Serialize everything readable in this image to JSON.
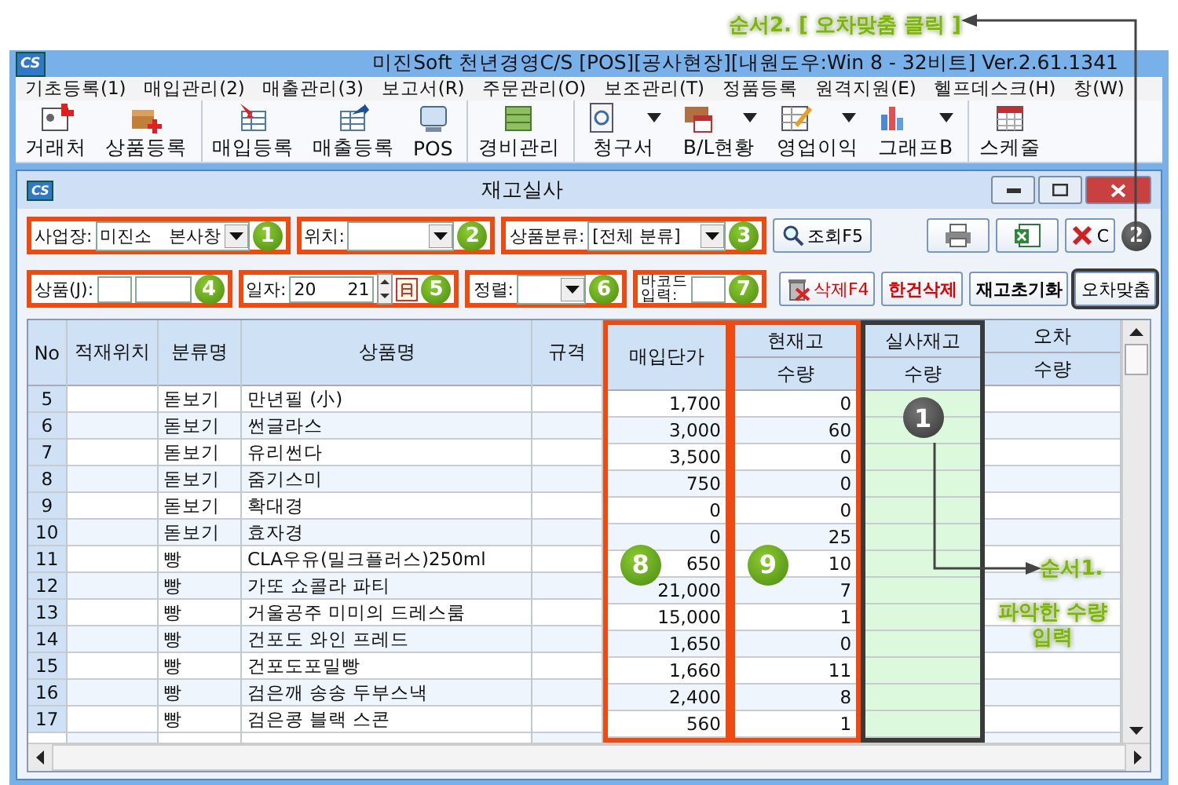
{
  "annotation_top": {
    "text": "순서2. [ 오차맞춤 클릭 ]"
  },
  "window": {
    "icon": "CS",
    "title": "미진Soft 천년경영C/S [POS][공사현장][내원도우:Win 8 - 32비트] Ver.2.61.1341"
  },
  "menu": [
    "기초등록(1)",
    "매입관리(2)",
    "매출관리(3)",
    "보고서(R)",
    "주문관리(O)",
    "보조관리(T)",
    "정품등록",
    "원격지원(E)",
    "헬프데스크(H)",
    "창(W)"
  ],
  "toolbar": [
    {
      "label": "거래처",
      "dropdown": false,
      "separator_before": false
    },
    {
      "label": "상품등록",
      "dropdown": false,
      "separator_before": false
    },
    {
      "label": "매입등록",
      "dropdown": false,
      "separator_before": true
    },
    {
      "label": "매출등록",
      "dropdown": false,
      "separator_before": false
    },
    {
      "label": "POS",
      "dropdown": false,
      "separator_before": false
    },
    {
      "label": "경비관리",
      "dropdown": false,
      "separator_before": true
    },
    {
      "label": "청구서",
      "dropdown": true,
      "separator_before": true
    },
    {
      "label": "B/L현황",
      "dropdown": true,
      "separator_before": false
    },
    {
      "label": "영업이익",
      "dropdown": true,
      "separator_before": false
    },
    {
      "label": "그래프B",
      "dropdown": true,
      "separator_before": false
    },
    {
      "label": "스케줄",
      "dropdown": false,
      "separator_before": true
    }
  ],
  "inner_window": {
    "icon": "CS",
    "title": "재고실사"
  },
  "filter_row_1": [
    {
      "kind": "combo",
      "label": "사업장:",
      "value_parts": [
        "미진소",
        "본사창"
      ],
      "badge": "1"
    },
    {
      "kind": "combo",
      "label": "위치:",
      "badge": "2"
    },
    {
      "kind": "combo",
      "label": "상품분류:",
      "value_parts": [
        "[전체 분류]"
      ],
      "badge": "3"
    }
  ],
  "search_button": {
    "label": "조회F5"
  },
  "close_button": {
    "label": "C",
    "badge": "2"
  },
  "filter_row_2": [
    {
      "kind": "product",
      "label": "상품(J):",
      "badge": "4"
    },
    {
      "kind": "date",
      "label": "일자:",
      "value_parts": [
        "20",
        "21"
      ],
      "badge": "5"
    },
    {
      "kind": "combo",
      "label": "정렬:",
      "badge": "6"
    },
    {
      "kind": "text",
      "label": "바코드\n입력:",
      "badge": "7"
    }
  ],
  "action_buttons": [
    {
      "label": "삭제F4",
      "color": "#e00000",
      "bold": false,
      "trash_icon": true,
      "framed": false
    },
    {
      "label": "한건삭제",
      "color": "#e00000",
      "bold": true,
      "trash_icon": false,
      "framed": false
    },
    {
      "label": "재고초기화",
      "color": "#000000",
      "bold": true,
      "trash_icon": false,
      "framed": false
    },
    {
      "label": "오차맞춤",
      "color": "#000000",
      "bold": false,
      "trash_icon": false,
      "framed": true
    }
  ],
  "table": {
    "columns": [
      {
        "header": "No"
      },
      {
        "header": "적재위치"
      },
      {
        "header": "분류명"
      },
      {
        "header": "상품명"
      },
      {
        "header": "규격"
      },
      {
        "header": "매입단가",
        "callout": {
          "kind": "orange",
          "badge": "8"
        }
      },
      {
        "header": "현재고",
        "subheader": "수량",
        "callout": {
          "kind": "orange",
          "badge": "9"
        }
      },
      {
        "header": "실사재고",
        "subheader": "수량",
        "callout": {
          "kind": "dark",
          "badge": "1"
        },
        "editable": true
      },
      {
        "header": "오차",
        "subheader": "수량"
      }
    ],
    "rows": [
      {
        "no": "5",
        "category": "돋보기",
        "name": "만년필 (小)",
        "price": "1,700",
        "stock": "0"
      },
      {
        "no": "6",
        "category": "돋보기",
        "name": "썬글라스",
        "price": "3,000",
        "stock": "60"
      },
      {
        "no": "7",
        "category": "돋보기",
        "name": "유리썬다",
        "price": "3,500",
        "stock": "0"
      },
      {
        "no": "8",
        "category": "돋보기",
        "name": "줌기스미",
        "price": "750",
        "stock": "0"
      },
      {
        "no": "9",
        "category": "돋보기",
        "name": "확대경",
        "price": "0",
        "stock": "0"
      },
      {
        "no": "10",
        "category": "돋보기",
        "name": "효자경",
        "price": "0",
        "stock": "25"
      },
      {
        "no": "11",
        "category": "빵",
        "name": "CLA우유(밀크플러스)250ml",
        "price": "650",
        "stock": "10"
      },
      {
        "no": "12",
        "category": "빵",
        "name": "가또 쇼콜라 파티",
        "price": "21,000",
        "stock": "7"
      },
      {
        "no": "13",
        "category": "빵",
        "name": "거울공주 미미의 드레스룸",
        "price": "15,000",
        "stock": "1"
      },
      {
        "no": "14",
        "category": "빵",
        "name": "건포도 와인 프레드",
        "price": "1,650",
        "stock": "0"
      },
      {
        "no": "15",
        "category": "빵",
        "name": "건포도포밀빵",
        "price": "1,660",
        "stock": "11"
      },
      {
        "no": "16",
        "category": "빵",
        "name": "검은깨 송송 두부스낵",
        "price": "2,400",
        "stock": "8"
      },
      {
        "no": "17",
        "category": "빵",
        "name": "검은콩 블랙 스콘",
        "price": "560",
        "stock": "1"
      }
    ]
  },
  "step_1_note": {
    "title": "순서1.",
    "text": "파악한 수량\n입력"
  }
}
